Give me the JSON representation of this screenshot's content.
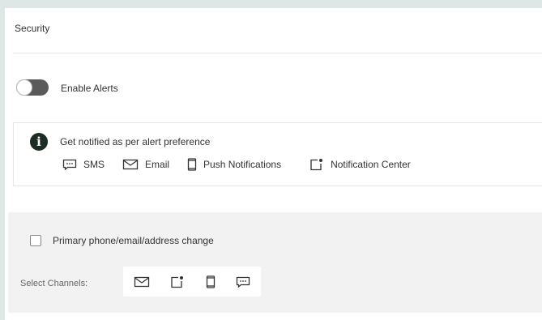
{
  "section": {
    "title": "Security"
  },
  "alerts_toggle": {
    "label": "Enable Alerts",
    "enabled": false
  },
  "info": {
    "message": "Get notified as per alert preference",
    "channels": [
      {
        "label": "SMS",
        "icon": "sms-icon"
      },
      {
        "label": "Email",
        "icon": "email-icon"
      },
      {
        "label": "Push Notifications",
        "icon": "phone-icon"
      },
      {
        "label": "Notification Center",
        "icon": "notification-center-icon"
      }
    ]
  },
  "alert_item": {
    "label": "Primary phone/email/address change",
    "checked": false,
    "select_channels_label": "Select Channels:",
    "channel_icons": [
      "email-icon",
      "notification-center-icon",
      "phone-icon",
      "sms-icon"
    ]
  },
  "colors": {
    "toggle_off": "#5a5a5a",
    "info_icon": "#1e2d23",
    "section_bg": "#f2f2f2"
  }
}
